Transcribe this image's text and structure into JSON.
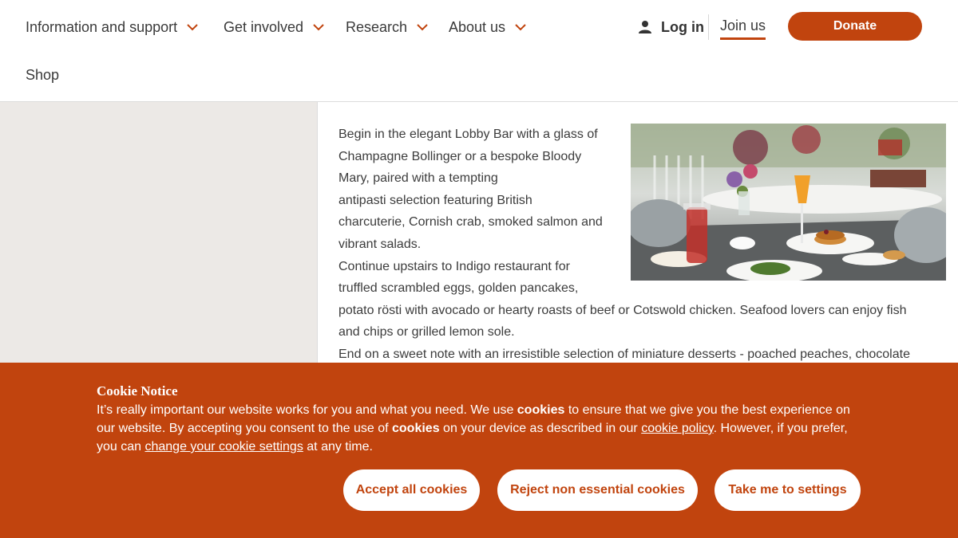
{
  "nav": {
    "items": [
      {
        "label": "Information and support"
      },
      {
        "label": "Get involved"
      },
      {
        "label": "Research"
      },
      {
        "label": "About us"
      }
    ],
    "shop": "Shop",
    "login": "Log in",
    "join": "Join us",
    "donate": "Donate"
  },
  "article": {
    "lines": [
      "Begin in the elegant Lobby Bar with a glass of",
      "Champagne Bollinger or a bespoke Bloody",
      "Mary, paired with a tempting",
      "antipasti selection featuring British",
      "charcuterie, Cornish crab, smoked salmon and",
      "vibrant salads.",
      "Continue upstairs to Indigo restaurant for",
      "truffled scrambled eggs, golden pancakes,",
      "potato rösti with avocado or hearty roasts of beef or Cotswold chicken. Seafood lovers can enjoy fish",
      "and chips or grilled lemon sole.",
      "End on a sweet note with an irresistible selection of miniature desserts - poached peaches, chocolate"
    ]
  },
  "cookie": {
    "title": "Cookie Notice",
    "t1": "It’s really important our website works for you and what you need. We use ",
    "t2": "cookies",
    "t3": " to ensure that we give you the best experience on our website. By accepting you consent to the use of ",
    "t4": "cookies",
    "t5": " on your device as described in our ",
    "policy_link": "cookie policy",
    "t6": ". However, if you prefer, you can ",
    "settings_link": "change your cookie settings",
    "t7": " at any time.",
    "buttons": {
      "accept": "Accept all cookies",
      "reject": "Reject non essential cookies",
      "settings": "Take me to settings"
    }
  },
  "colors": {
    "brand": "#c1440e",
    "sidebar": "#ece9e6"
  }
}
